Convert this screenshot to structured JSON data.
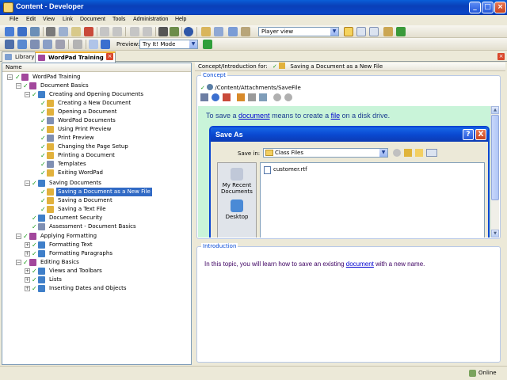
{
  "window": {
    "title": "Content - Developer"
  },
  "menu": [
    "File",
    "Edit",
    "View",
    "Link",
    "Document",
    "Tools",
    "Administration",
    "Help"
  ],
  "toolbar": {
    "view_combo": "Player view",
    "preview_label": "Preview:",
    "preview_mode": "Try It! Mode"
  },
  "tabs": [
    {
      "label": "Library"
    },
    {
      "label": "WordPad Training"
    }
  ],
  "tree": {
    "header": "Name",
    "items": [
      {
        "label": "WordPad Training"
      },
      {
        "label": "Document Basics"
      },
      {
        "label": "Creating and Opening Documents"
      },
      {
        "label": "Creating a New Document"
      },
      {
        "label": "Opening a Document"
      },
      {
        "label": "WordPad Documents"
      },
      {
        "label": "Using Print Preview"
      },
      {
        "label": "Print Preview"
      },
      {
        "label": "Changing the Page Setup"
      },
      {
        "label": "Printing a Document"
      },
      {
        "label": "Templates"
      },
      {
        "label": "Exiting WordPad"
      },
      {
        "label": "Saving Documents"
      },
      {
        "label": "Saving a Document as a New File"
      },
      {
        "label": "Saving a Document"
      },
      {
        "label": "Saving a Text File"
      },
      {
        "label": "Document Security"
      },
      {
        "label": "Assessment - Document Basics"
      },
      {
        "label": "Applying Formatting"
      },
      {
        "label": "Formatting Text"
      },
      {
        "label": "Formatting Paragraphs"
      },
      {
        "label": "Editing Basics"
      },
      {
        "label": "Views and Toolbars"
      },
      {
        "label": "Lists"
      },
      {
        "label": "Inserting Dates and Objects"
      }
    ]
  },
  "right": {
    "header_label": "Concept/Introduction for:",
    "header_value": "Saving a Document as a New File",
    "concept_title": "Concept",
    "concept_path": "/Content/Attachments/SaveFile",
    "concept_text": {
      "part1": "To save a ",
      "link1": "document",
      "part2": " means to create a ",
      "link2": "file",
      "part3": " on a disk drive."
    },
    "dialog": {
      "title": "Save As",
      "help_btn": "?",
      "close_btn": "X",
      "save_in_label": "Save in:",
      "save_in_value": "Class Files",
      "places": [
        {
          "label": "My Recent Documents"
        },
        {
          "label": "Desktop"
        }
      ],
      "files": [
        "customer.rtf"
      ]
    },
    "intro_title": "Introduction",
    "intro_text": {
      "part1": "In this topic, you will learn how to save an existing ",
      "link1": "document",
      "part2": " with a new name."
    }
  },
  "status": {
    "online": "Online"
  }
}
